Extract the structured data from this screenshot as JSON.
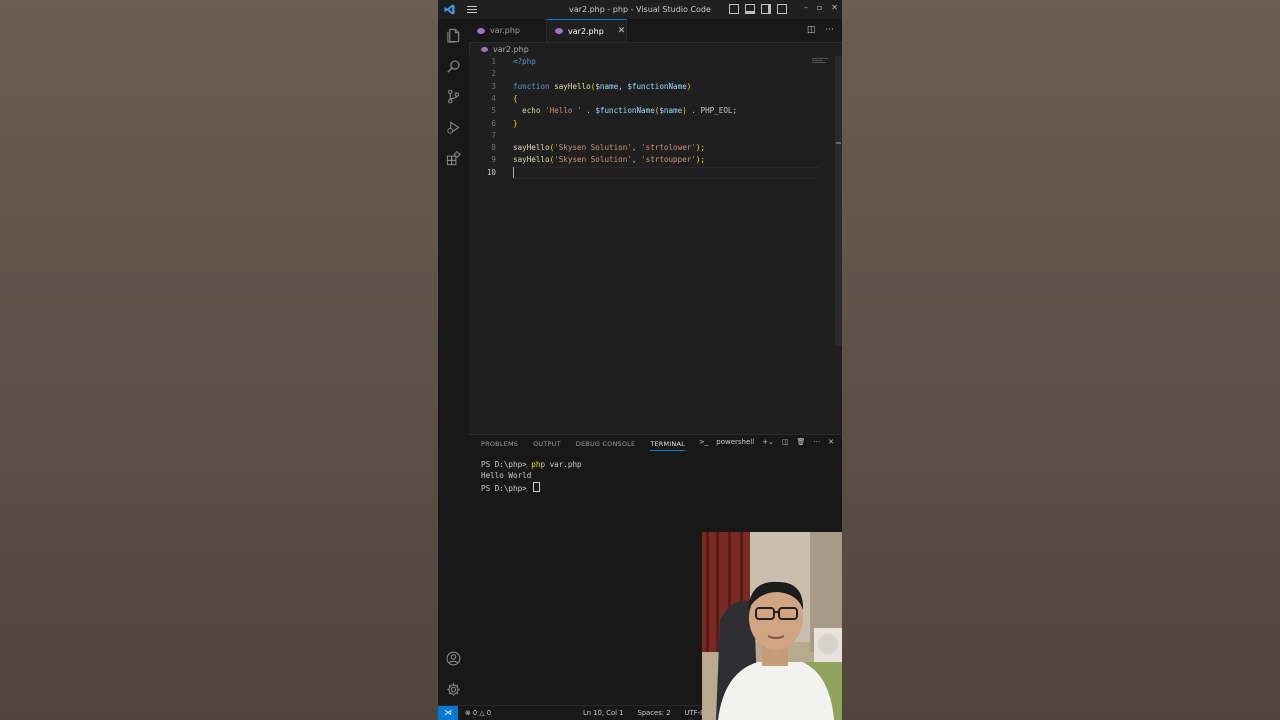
{
  "window": {
    "title": "var2.php - php - Visual Studio Code",
    "controls": [
      "–",
      "▫",
      "✕"
    ]
  },
  "tabs": [
    {
      "label": "var.php"
    },
    {
      "label": "var2.php",
      "close": "✕"
    }
  ],
  "breadcrumb": "var2.php",
  "editor": {
    "lines": [
      {
        "num": "1"
      },
      {
        "num": "2"
      },
      {
        "num": "3"
      },
      {
        "num": "4"
      },
      {
        "num": "5"
      },
      {
        "num": "6"
      },
      {
        "num": "7"
      },
      {
        "num": "8"
      },
      {
        "num": "9"
      },
      {
        "num": "10"
      }
    ],
    "tokens": {
      "l1": "<?php",
      "l3_kw": "function",
      "l3_fn": "sayHello",
      "l3_p1": "(",
      "l3_v1": "$name",
      "l3_c": ", ",
      "l3_v2": "$functionName",
      "l3_p2": ")",
      "l4": "{",
      "l5_echo": "echo",
      "l5_str": "'Hello '",
      "l5_dot1": " . ",
      "l5_v1": "$functionName",
      "l5_p1": "(",
      "l5_v2": "$name",
      "l5_p2": ")",
      "l5_rest": " . PHP_EOL;",
      "l6": "}",
      "l8_fn": "sayHello",
      "l8_p1": "(",
      "l8_s1": "'Skysen Solution'",
      "l8_c": ", ",
      "l8_s2": "'strtolower'",
      "l8_p2": ");",
      "l9_fn": "sayHello",
      "l9_p1": "(",
      "l9_s1": "'Skysen Solution'",
      "l9_c": ", ",
      "l9_s2": "'strtoupper'",
      "l9_p2": ");"
    }
  },
  "panel": {
    "tabs": [
      "PROBLEMS",
      "OUTPUT",
      "DEBUG CONSOLE",
      "TERMINAL"
    ],
    "active_tab": "TERMINAL",
    "shell": "powershell",
    "terminal": {
      "line1_prompt": "PS D:\\php> ",
      "line1_cmd": "php",
      "line1_arg": " var.php",
      "line2": "Hello World",
      "line3_prompt": "PS D:\\php> "
    }
  },
  "status": {
    "errors": "0",
    "warnings": "0",
    "position": "Ln 10, Col 1",
    "spaces": "Spaces: 2",
    "encoding": "UTF-8"
  }
}
